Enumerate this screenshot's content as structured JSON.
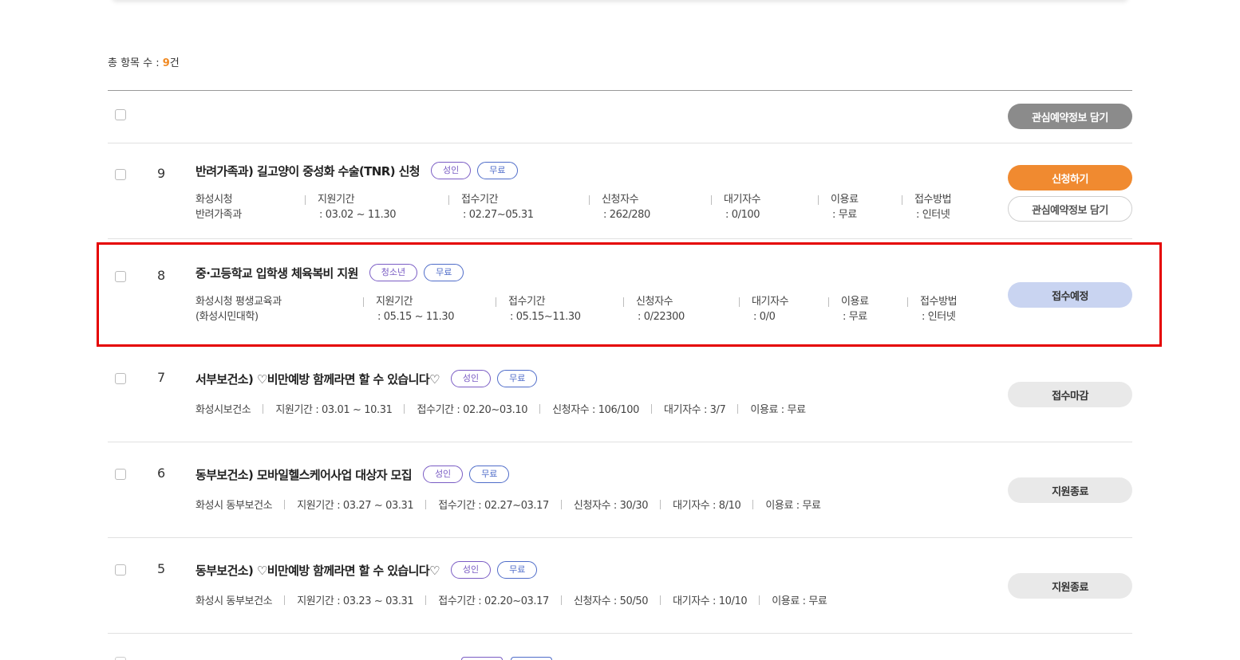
{
  "summary": {
    "label": "총 항목 수 : ",
    "count": "9",
    "unit": "건"
  },
  "header": {
    "bulk_button": "관심예약정보 담기"
  },
  "items": [
    {
      "num": "9",
      "title": "반려가족과) 길고양이 중성화 수술(TNR) 신청",
      "tags": [
        "성인",
        "무료"
      ],
      "meta": [
        {
          "label": "화성시청",
          "value": "반려가족과"
        },
        {
          "label": "지원기간",
          "value": ": 03.02 ~ 11.30"
        },
        {
          "label": "접수기간",
          "value": ": 02.27~05.31"
        },
        {
          "label": "신청자수",
          "value": ": 262/280"
        },
        {
          "label": "대기자수",
          "value": ": 0/100"
        },
        {
          "label": "이용료",
          "value": ": 무료"
        },
        {
          "label": "접수방법",
          "value": ": 인터넷"
        }
      ],
      "buttons": [
        "신청하기",
        "관심예약정보 담기"
      ]
    },
    {
      "num": "8",
      "title": "중·고등학교 입학생 체육복비 지원",
      "tags": [
        "청소년",
        "무료"
      ],
      "meta": [
        {
          "label": "화성시청 평생교육과",
          "value": "(화성시민대학)"
        },
        {
          "label": "지원기간",
          "value": ": 05.15 ~ 11.30"
        },
        {
          "label": "접수기간",
          "value": ": 05.15~11.30"
        },
        {
          "label": "신청자수",
          "value": ": 0/22300"
        },
        {
          "label": "대기자수",
          "value": ": 0/0"
        },
        {
          "label": "이용료",
          "value": ": 무료"
        },
        {
          "label": "접수방법",
          "value": ": 인터넷"
        }
      ],
      "buttons": [
        "접수예정"
      ]
    },
    {
      "num": "7",
      "title": "서부보건소) ♡비만예방 함께라면 할 수 있습니다♡",
      "tags": [
        "성인",
        "무료"
      ],
      "meta_line": [
        "화성시보건소",
        "지원기간 : 03.01 ~ 10.31",
        "접수기간 : 02.20~03.10",
        "신청자수 : 106/100",
        "대기자수 : 3/7",
        "이용료 : 무료"
      ],
      "buttons": [
        "접수마감"
      ]
    },
    {
      "num": "6",
      "title": "동부보건소) 모바일헬스케어사업 대상자 모집",
      "tags": [
        "성인",
        "무료"
      ],
      "meta_line": [
        "화성시 동부보건소",
        "지원기간 : 03.27 ~ 03.31",
        "접수기간 : 02.27~03.17",
        "신청자수 : 30/30",
        "대기자수 : 8/10",
        "이용료 : 무료"
      ],
      "buttons": [
        "지원종료"
      ]
    },
    {
      "num": "5",
      "title": "동부보건소) ♡비만예방 함께라면 할 수 있습니다♡",
      "tags": [
        "성인",
        "무료"
      ],
      "meta_line": [
        "화성시 동부보건소",
        "지원기간 : 03.23 ~ 03.31",
        "접수기간 : 02.20~03.17",
        "신청자수 : 50/50",
        "대기자수 : 10/10",
        "이용료 : 무료"
      ],
      "buttons": [
        "지원종료"
      ]
    }
  ],
  "colors": {
    "accent_orange": "#f08a30",
    "highlight_red": "#e50000",
    "tag_purple": "#7a5cc4",
    "tag_blue": "#4f6cc9",
    "scheduled_blue": "#c9d4f1"
  }
}
